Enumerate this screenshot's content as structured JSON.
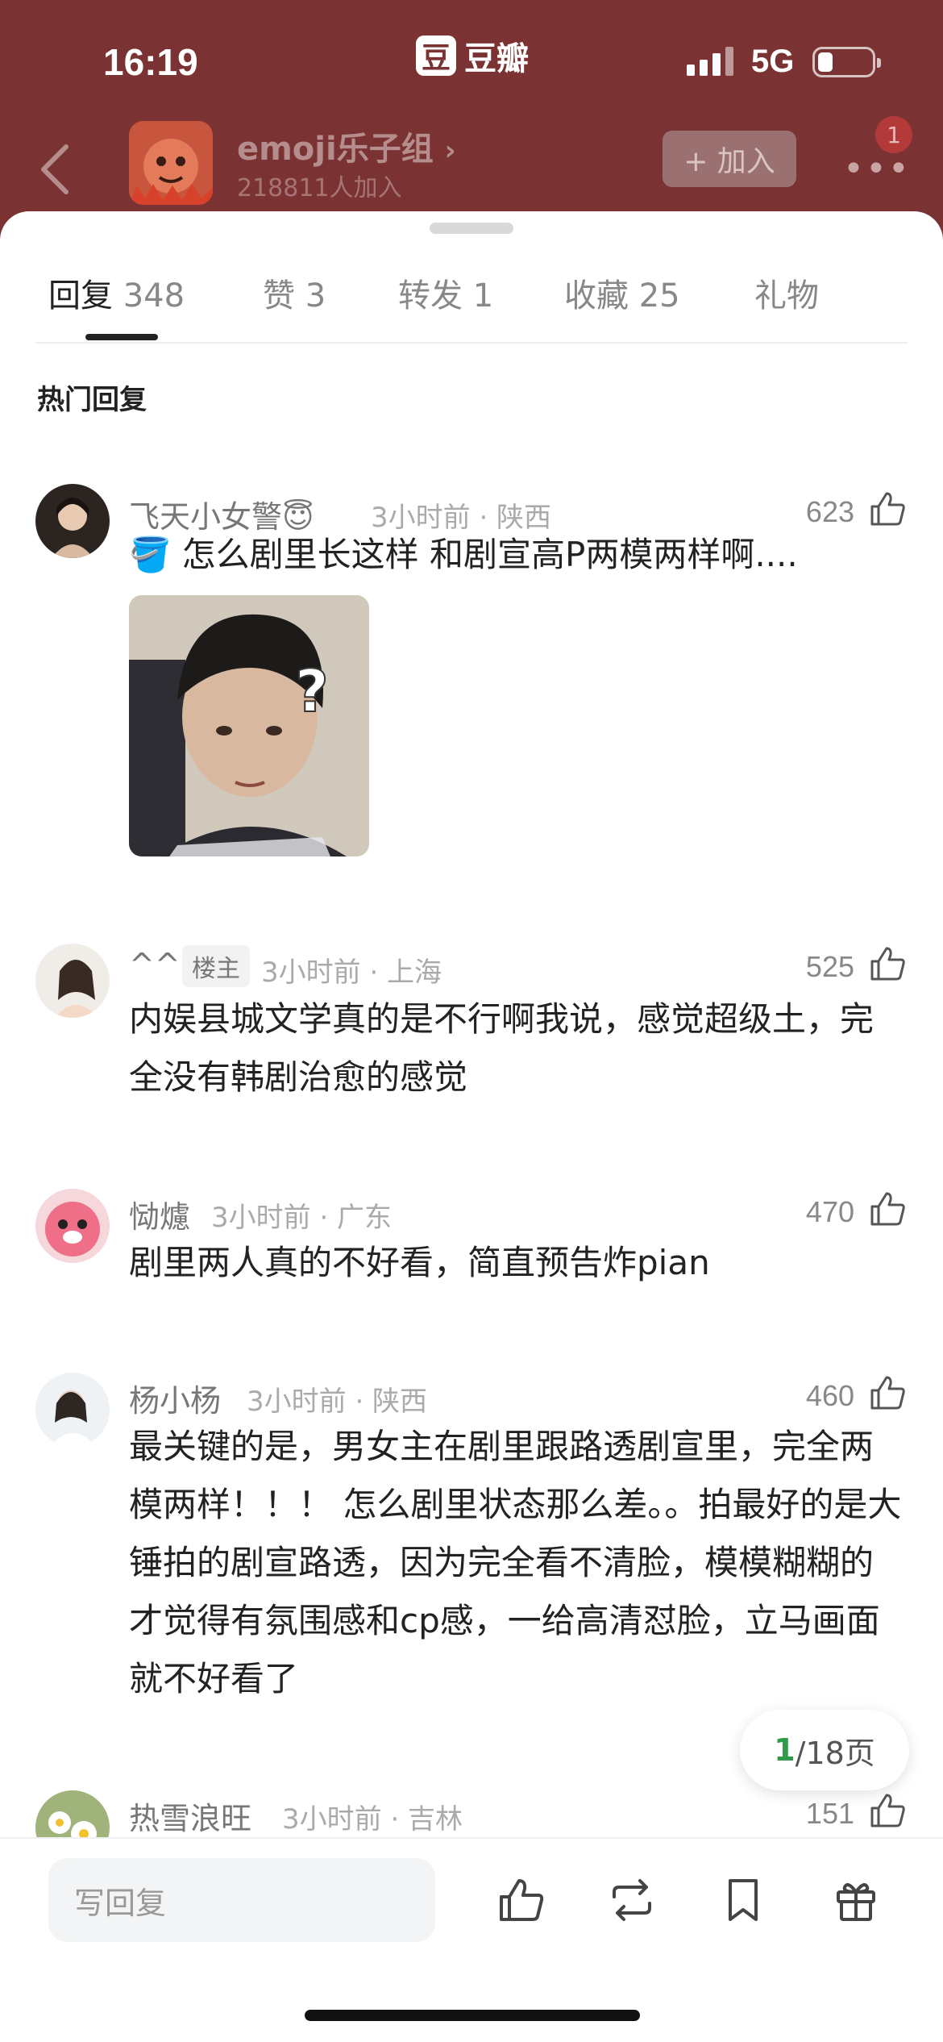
{
  "status_bar": {
    "time": "16:19",
    "app_name": "豆瓣",
    "app_logo_char": "豆",
    "network": "5G"
  },
  "group": {
    "name": "emoji乐子组",
    "members": "218811人加入",
    "join_label": "+ 加入",
    "notification_count": "1"
  },
  "tabs": [
    {
      "label": "回复",
      "count": "348"
    },
    {
      "label": "赞",
      "count": "3"
    },
    {
      "label": "转发",
      "count": "1"
    },
    {
      "label": "收藏",
      "count": "25"
    },
    {
      "label": "礼物",
      "count": ""
    }
  ],
  "section_title": "热门回复",
  "comments": [
    {
      "user": "飞天小女警😇",
      "time_location": "3小时前 · 陕西",
      "likes": "623",
      "text": "🪣 怎么剧里长这样 和剧宣高P两模两样啊....",
      "has_image": true
    },
    {
      "user": "^^",
      "op_badge": "楼主",
      "time_location": "3小时前 · 上海",
      "likes": "525",
      "text": "内娱县城文学真的是不行啊我说，感觉超级土，完全没有韩剧治愈的感觉"
    },
    {
      "user": "恸爈",
      "time_location": "3小时前 · 广东",
      "likes": "470",
      "text": "剧里两人真的不好看，简直预告炸pian"
    },
    {
      "user": "杨小杨",
      "time_location": "3小时前 · 陕西",
      "likes": "460",
      "text": "最关键的是，男女主在剧里跟路透剧宣里，完全两模两样！！！ 怎么剧里状态那么差。。拍最好的是大锤拍的剧宣路透，因为完全看不清脸，模模糊糊的才觉得有氛围感和cp感，一给高清怼脸，立马画面就不好看了"
    },
    {
      "user": "热雪浪旺",
      "time_location": "3小时前 · 吉林",
      "likes": "151",
      "text": ""
    }
  ],
  "pagination": {
    "current": "1",
    "total": "/18页"
  },
  "bottom_bar": {
    "reply_placeholder": "写回复"
  },
  "colors": {
    "header_bg": "#7b3233",
    "accent_green": "#2e9b4a"
  }
}
